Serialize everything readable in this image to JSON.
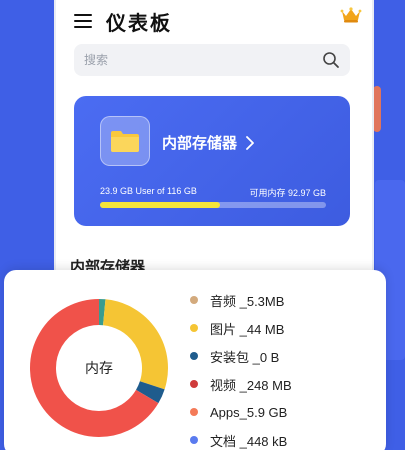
{
  "header": {
    "title": "仪表板",
    "crown_icon": "crown-icon",
    "menu_icon": "hamburger-menu-icon"
  },
  "search": {
    "placeholder": "搜索",
    "value": ""
  },
  "storage_card": {
    "title": "内部存储器",
    "used_text": "23.9 GB User of 116 GB",
    "free_text": "可用内存 92.97 GB",
    "progress_fraction": 0.53,
    "bar_color": "#f5e53a",
    "card_color": "#4563eb"
  },
  "section": {
    "title": "内部存储器"
  },
  "chart_data": {
    "type": "pie",
    "center_label": "内存",
    "categories": [
      "音频",
      "图片",
      "安装包",
      "视频",
      "Apps",
      "文档"
    ],
    "values": [
      5.3,
      44,
      0,
      248,
      5.9,
      0.448
    ],
    "units": [
      "MB",
      "MB",
      "B",
      "MB",
      "GB",
      "kB"
    ],
    "value_texts": [
      "5.3MB",
      "44 MB",
      "0 B",
      "248 MB",
      "5.9 GB",
      "448 kB"
    ],
    "legend_labels": [
      "音频 _5.3MB",
      "图片 _44 MB",
      "安装包 _0 B",
      "视频 _248 MB",
      "Apps_5.9 GB",
      "文档 _448 kB"
    ],
    "colors": [
      "#d3aa7d",
      "#f5c534",
      "#1f5c8d",
      "#cf3b3b",
      "#f47a58",
      "#5a7bef"
    ],
    "display_fractions": [
      0.015,
      0.285,
      0.035,
      0.0,
      0.665,
      0.0
    ],
    "ring_colors": [
      "#3a9c8f",
      "#f5c534",
      "#1f5c8d",
      "#cf3b3b",
      "#f0524a",
      "#5a7bef"
    ],
    "legend_placement": "right"
  }
}
